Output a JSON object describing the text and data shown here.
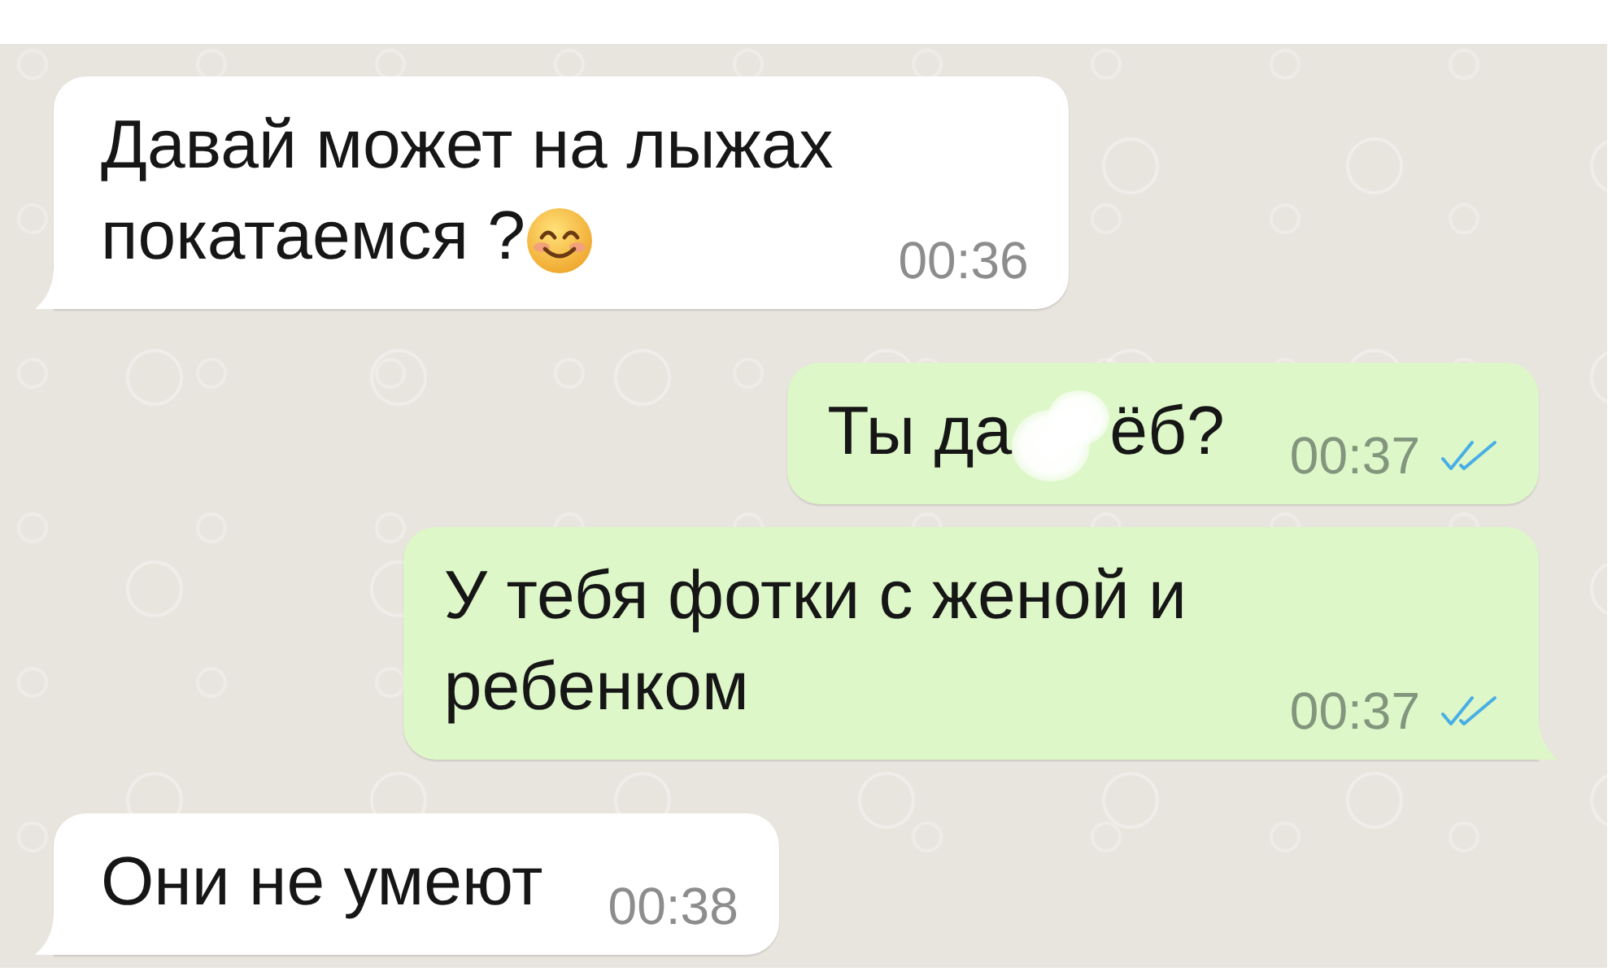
{
  "chat": {
    "messages": [
      {
        "outgoing": false,
        "tail": true,
        "lines": [
          [
            {
              "kind": "text",
              "text": "Давай может на лыжах"
            }
          ],
          [
            {
              "kind": "text",
              "text": "покатаемся ?"
            },
            {
              "kind": "emoji"
            }
          ]
        ],
        "time": "00:36"
      },
      {
        "outgoing": true,
        "tail": false,
        "lines": [
          [
            {
              "kind": "text",
              "text": "Ты да"
            },
            {
              "kind": "blot"
            },
            {
              "kind": "text",
              "text": "ёб?"
            }
          ]
        ],
        "time": "00:37",
        "read": true
      },
      {
        "outgoing": true,
        "tail": true,
        "lines": [
          [
            {
              "kind": "text",
              "text": "У тебя фотки с женой и ребенком"
            }
          ]
        ],
        "time": "00:37",
        "read": true
      },
      {
        "outgoing": false,
        "tail": true,
        "lines": [
          [
            {
              "kind": "text",
              "text": "Они не умеют"
            }
          ]
        ],
        "time": "00:38"
      }
    ]
  }
}
